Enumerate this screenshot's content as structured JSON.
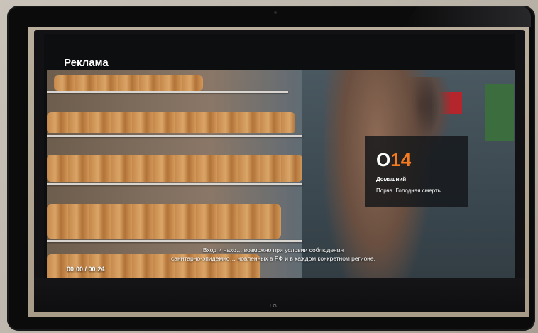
{
  "overlay": {
    "label": "Реклама",
    "timecode": "00:00 / 00:24"
  },
  "channel_card": {
    "prefix": "О",
    "number": "14",
    "channel_name": "Домашний",
    "program_title": "Порча. Голодная смерть",
    "accent_color": "#f47b20"
  },
  "disclaimer": {
    "line1": "Вход и нахо… возможно при условии соблюдения",
    "line2": "санитарно-эпидемио… новленных в РФ и в каждом конкретном регионе."
  },
  "tv": {
    "brand": "LG"
  }
}
